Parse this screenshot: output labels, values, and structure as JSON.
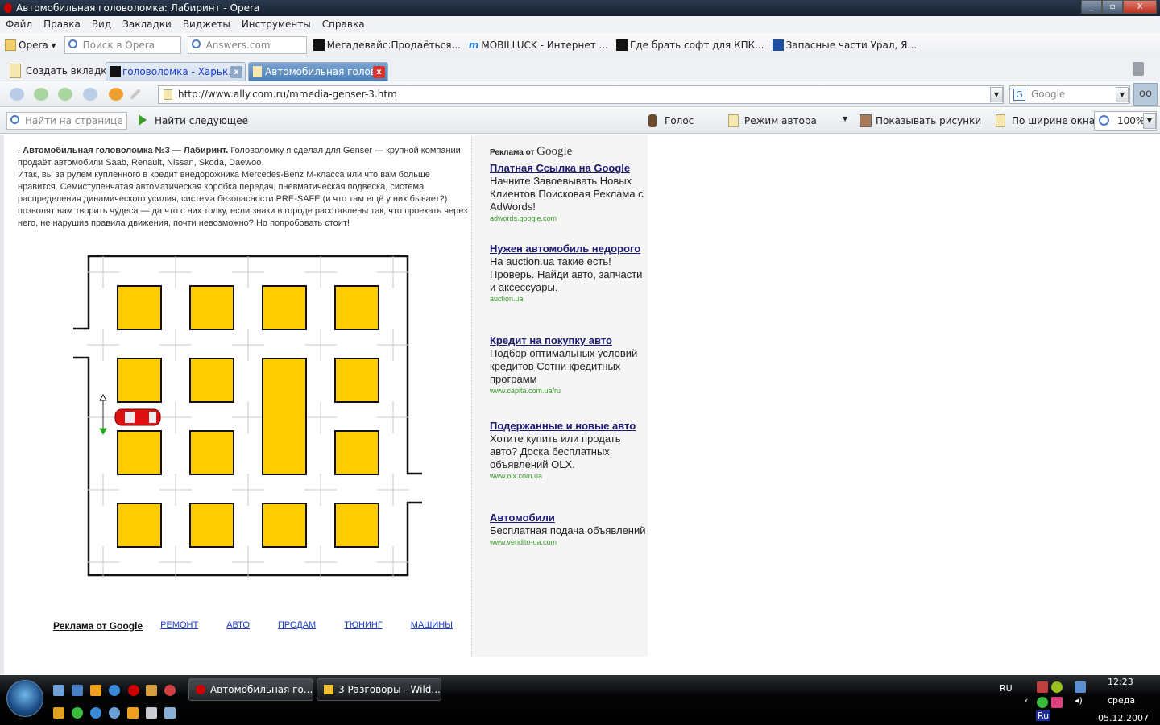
{
  "window": {
    "title": "Автомобильная головоломка: Лабиринт - Opera",
    "min": "_",
    "max": "▫",
    "close": "X"
  },
  "menu": [
    "Файл",
    "Правка",
    "Вид",
    "Закладки",
    "Виджеты",
    "Инструменты",
    "Справка"
  ],
  "bookmarks_bar": {
    "opera": "Opera",
    "search_placeholder": "Поиск в Opera",
    "answers_placeholder": "Answers.com",
    "items": [
      "Мегадевайс:Продаёться...",
      "MOBILLUCK - Интернет ...",
      "Где брать софт для КПК...",
      "Запасные части Урал, Я..."
    ]
  },
  "tabs": {
    "new_tab": "Создать вкладку",
    "items": [
      {
        "label": "головоломка - Харьк...",
        "close": "x"
      },
      {
        "label": "Автомобильная голов...",
        "close": "x"
      }
    ]
  },
  "nav": {
    "url": "http://www.ally.com.ru/mmedia-genser-3.htm",
    "search_engine": "Google"
  },
  "findbar": {
    "find_placeholder": "Найти на странице",
    "find_next": "Найти следующее",
    "voice": "Голос",
    "author_mode": "Режим автора",
    "show_images": "Показывать рисунки",
    "fit_width": "По ширине окна",
    "zoom": "100%"
  },
  "article": {
    "bullet": ".",
    "title": "Автомобильная головоломка №3 — Лабиринт.",
    "p1": " Головоломку я сделал для Genser — крупной компании, продаёт автомобили Saab, Renault, Nissan, Skoda, Daewoo.",
    "p2": "Итак, вы за рулем купленного в кредит внедорожника Mercedes-Benz M-класса или что вам больше нравится. Семиступенчатая автоматическая коробка передач, пневматическая подвеска, система распределения динамического усилия, система безопасности PRE-SAFE (и что там ещё у них бывает?) позволят вам творить чудеса — да что с них толку, если знаки в городе расставлены так, что проехать через него, не нарушив правила движения, почти невозможно? Но попробовать стоит!"
  },
  "ads": {
    "header": "Реклама от",
    "header_brand": "Google",
    "items": [
      {
        "title": "Платная Ссылка на Google",
        "text": "Начните Завоевывать Новых Клиентов Поисковая Реклама с AdWords!",
        "url": "adwords.google.com"
      },
      {
        "title": "Нужен автомобиль недорого",
        "text": "На auction.ua такие есть! Проверь. Найди авто, запчасти и аксессуары.",
        "url": "auction.ua"
      },
      {
        "title": "Кредит на покупку авто",
        "text": "Подбор оптимальных условий кредитов Сотни кредитных программ",
        "url": "www.capita.com.ua/ru"
      },
      {
        "title": "Подержанные и новые авто",
        "text": "Хотите купить или продать авто? Доска бесплатных объявлений OLX.",
        "url": "www.olx.com.ua"
      },
      {
        "title": "Автомобили",
        "text": "Бесплатная подача объявлений",
        "url": "www.vendito-ua.com"
      }
    ]
  },
  "bottom_links": {
    "header": "Реклама от Google",
    "items": [
      "РЕМОНТ",
      "АВТО",
      "ПРОДАМ",
      "ТЮНИНГ",
      "МАШИНЫ"
    ]
  },
  "colors": {
    "block": "#ffcc00",
    "car": "#dd1111",
    "ad_title": "#1b1a70",
    "ad_url": "#3a9a2a"
  },
  "taskbar": {
    "tasks": [
      "Автомобильная го...",
      "3 Разговоры - Wild..."
    ],
    "lang": "RU",
    "lang2": "Ru",
    "time": "12:23",
    "day": "среда",
    "date": "05.12.2007"
  }
}
